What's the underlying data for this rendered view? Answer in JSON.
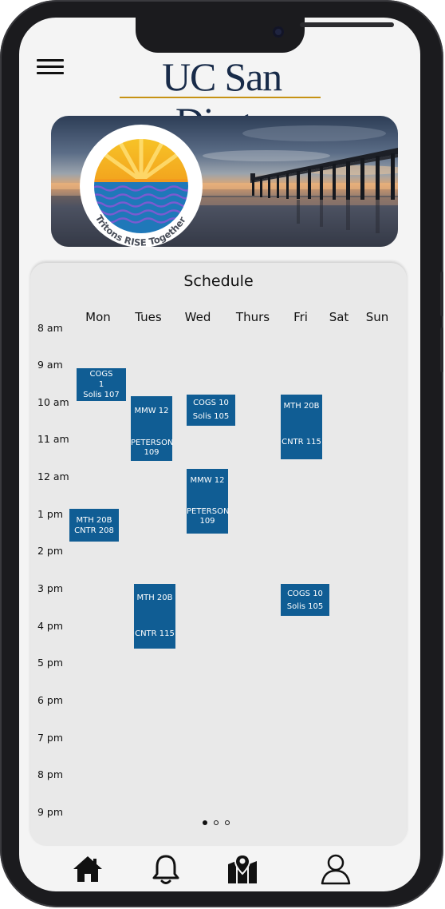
{
  "header": {
    "logo_text": "UC San Diego",
    "banner_badge_text": "Tritons RISE Together",
    "colors": {
      "navy": "#182b49",
      "gold": "#c69214",
      "class_block": "#105d94"
    }
  },
  "schedule": {
    "title": "Schedule",
    "days": [
      "Mon",
      "Tues",
      "Wed",
      "Thurs",
      "Fri",
      "Sat",
      "Sun"
    ],
    "hours": [
      "8 am",
      "9 am",
      "10 am",
      "11 am",
      "12 am",
      "1 pm",
      "2 pm",
      "3 pm",
      "4 pm",
      "5 pm",
      "6 pm",
      "7 pm",
      "8 pm",
      "9 pm"
    ],
    "classes": [
      {
        "line1": "COGS",
        "line2": "1",
        "line3": "Solis 107"
      },
      {
        "line1": "MMW 12",
        "line2": "PETERSON",
        "line3": "109"
      },
      {
        "line1": "COGS 10",
        "line2": "Solis 105"
      },
      {
        "line1": "MTH 20B",
        "line2": "CNTR 115"
      },
      {
        "line1": "MMW 12",
        "line2": "PETERSON",
        "line3": "109"
      },
      {
        "line1": "MTH 20B",
        "line2": "CNTR 208"
      },
      {
        "line1": "MTH 20B",
        "line2": "CNTR 115"
      },
      {
        "line1": "COGS 10",
        "line2": "Solis 105"
      }
    ],
    "pager": {
      "pages": 3,
      "current": 1
    }
  },
  "nav": {
    "items": [
      {
        "icon": "home-icon"
      },
      {
        "icon": "bell-icon"
      },
      {
        "icon": "map-pin-icon"
      },
      {
        "icon": "user-icon"
      }
    ]
  }
}
